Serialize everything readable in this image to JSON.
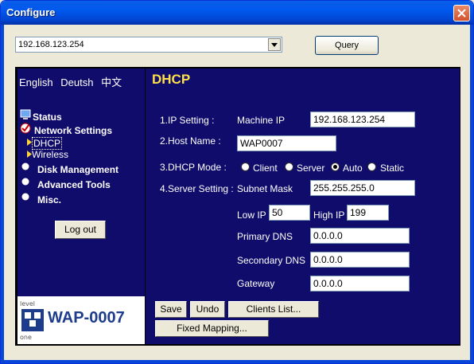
{
  "window": {
    "title": "Configure"
  },
  "toolbar": {
    "address": "192.168.123.254",
    "query_label": "Query"
  },
  "sidebar": {
    "languages": [
      "English",
      "Deutsh",
      "中文"
    ],
    "items": [
      {
        "label": "Status"
      },
      {
        "label": "Network Settings"
      },
      {
        "label": "DHCP"
      },
      {
        "label": "Wireless"
      },
      {
        "label": "Disk Management"
      },
      {
        "label": "Advanced Tools"
      },
      {
        "label": "Misc."
      }
    ],
    "logout_label": "Log out",
    "logo": {
      "brand": "level one",
      "model": "WAP-0007"
    }
  },
  "main": {
    "title": "DHCP",
    "ip_setting": {
      "label": "1.IP Setting :",
      "field_label": "Machine IP",
      "value": "192.168.123.254"
    },
    "host_name": {
      "label": "2.Host Name :",
      "value": "WAP0007"
    },
    "dhcp_mode": {
      "label": "3.DHCP Mode :",
      "options": [
        "Client",
        "Server",
        "Auto",
        "Static"
      ],
      "selected": "Auto"
    },
    "server_setting": {
      "label": "4.Server Setting :",
      "subnet_mask_label": "Subnet Mask",
      "subnet_mask": "255.255.255.0",
      "low_ip_label": "Low IP",
      "low_ip": "50",
      "high_ip_label": "High IP",
      "high_ip": "199",
      "primary_dns_label": "Primary DNS",
      "primary_dns": "0.0.0.0",
      "secondary_dns_label": "Secondary DNS",
      "secondary_dns": "0.0.0.0",
      "gateway_label": "Gateway",
      "gateway": "0.0.0.0"
    },
    "buttons": {
      "save": "Save",
      "undo": "Undo",
      "clients_list": "Clients List...",
      "fixed_mapping": "Fixed Mapping..."
    }
  }
}
